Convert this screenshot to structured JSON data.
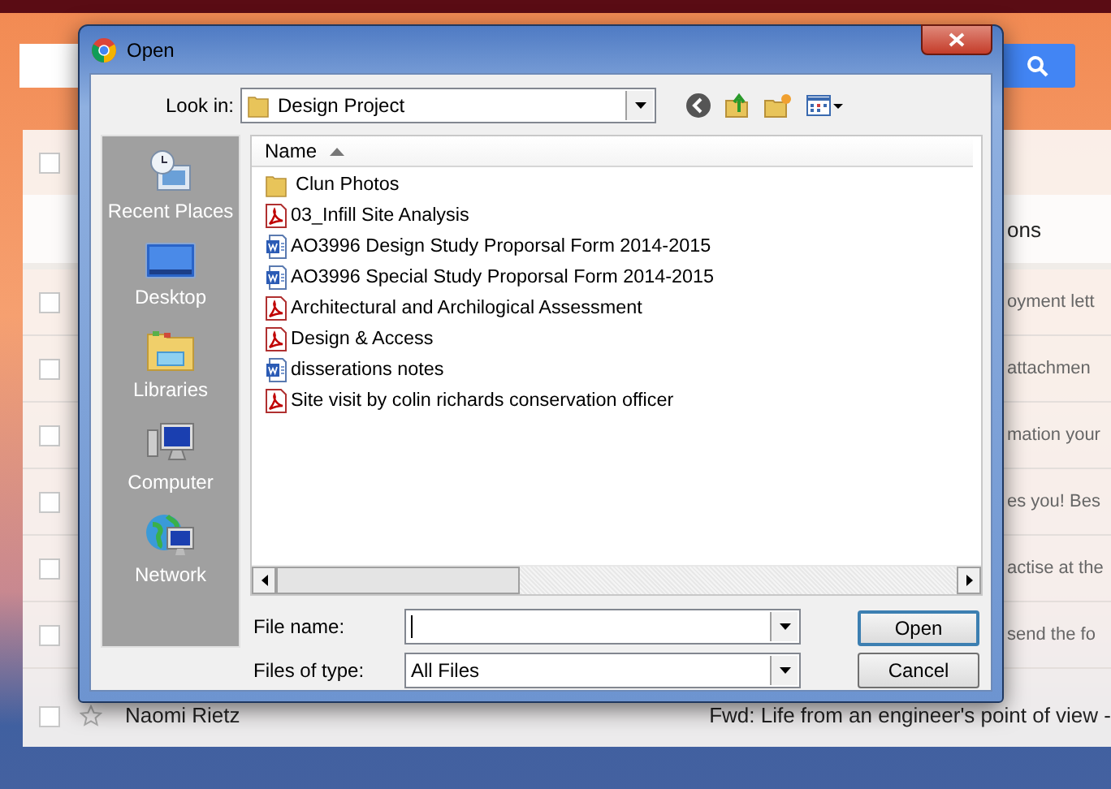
{
  "background_page": {
    "select_all_checked": false,
    "header_tab": "ons",
    "rows": [
      {
        "checked": false,
        "snippet": "oyment lett"
      },
      {
        "checked": false,
        "snippet": "attachmen"
      },
      {
        "checked": false,
        "snippet": "mation your"
      },
      {
        "checked": false,
        "snippet": "es you! Bes"
      },
      {
        "checked": false,
        "snippet": "actise at the"
      },
      {
        "checked": false,
        "snippet": "send the fo"
      }
    ],
    "last_row": {
      "checked": false,
      "starred": false,
      "sender": "Naomi Rietz",
      "subject": "Fwd: Life from an engineer's point of view -"
    }
  },
  "dialog": {
    "title": "Open",
    "look_in": {
      "label": "Look in:",
      "value": "Design Project"
    },
    "places": [
      {
        "kind": "recent",
        "label": "Recent Places"
      },
      {
        "kind": "desktop",
        "label": "Desktop"
      },
      {
        "kind": "libraries",
        "label": "Libraries"
      },
      {
        "kind": "computer",
        "label": "Computer"
      },
      {
        "kind": "network",
        "label": "Network"
      }
    ],
    "column": {
      "label": "Name",
      "sorted": true
    },
    "files": [
      {
        "kind": "folder",
        "name": "Clun Photos"
      },
      {
        "kind": "pdf",
        "name": "03_Infill Site Analysis"
      },
      {
        "kind": "word",
        "name": "AO3996 Design Study Proporsal Form 2014-2015"
      },
      {
        "kind": "word",
        "name": "AO3996 Special Study Proporsal Form 2014-2015"
      },
      {
        "kind": "pdf",
        "name": "Architectural and Archilogical Assessment"
      },
      {
        "kind": "pdf",
        "name": "Design & Access"
      },
      {
        "kind": "word",
        "name": "disserations notes"
      },
      {
        "kind": "pdf",
        "name": "Site visit by colin richards conservation officer"
      }
    ],
    "file_name": {
      "label": "File name:"
    },
    "files_of_type": {
      "label": "Files of type:",
      "value": "All Files"
    },
    "buttons": [
      {
        "label": "Open",
        "default": true
      },
      {
        "label": "Cancel",
        "default": false
      }
    ]
  }
}
